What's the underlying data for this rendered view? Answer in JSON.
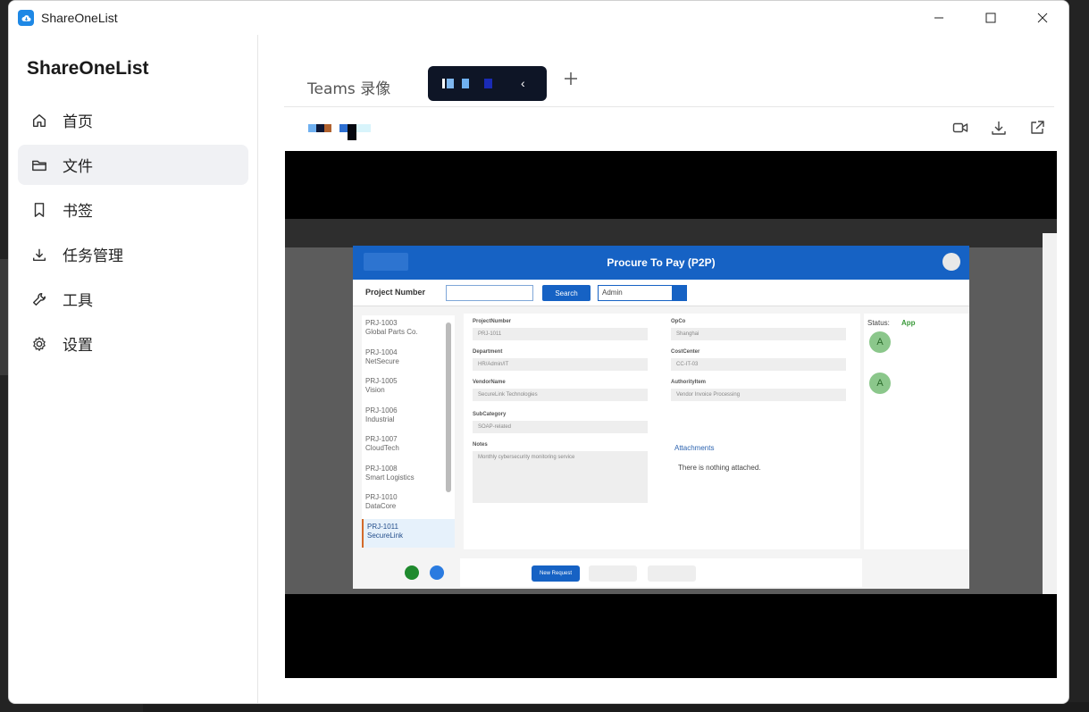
{
  "window": {
    "title": "ShareOneList",
    "controls": {
      "minimize": "minimize-icon",
      "maximize": "maximize-icon",
      "close": "close-icon"
    }
  },
  "sidebar": {
    "title": "ShareOneList",
    "items": [
      {
        "label": "首页",
        "icon": "home-icon",
        "active": false
      },
      {
        "label": "文件",
        "icon": "folder-icon",
        "active": true
      },
      {
        "label": "书签",
        "icon": "bookmark-icon",
        "active": false
      },
      {
        "label": "任务管理",
        "icon": "download-icon",
        "active": false
      },
      {
        "label": "工具",
        "icon": "wrench-icon",
        "active": false
      },
      {
        "label": "设置",
        "icon": "gear-icon",
        "active": false
      }
    ]
  },
  "tabs": {
    "first_label": "Teams 录像",
    "add_icon": "plus-icon"
  },
  "file_row": {
    "actions": [
      "video-icon",
      "download-icon",
      "open-external-icon"
    ]
  },
  "video": {
    "app_title": "Procure To Pay (P2P)",
    "project_number_label": "Project Number",
    "search_button": "Search",
    "select_value": "Admin",
    "projects": [
      {
        "id": "PRJ-1003",
        "name": "Global Parts Co."
      },
      {
        "id": "PRJ-1004",
        "name": "NetSecure"
      },
      {
        "id": "PRJ-1005",
        "name": "Vision"
      },
      {
        "id": "PRJ-1006",
        "name": "Industrial"
      },
      {
        "id": "PRJ-1007",
        "name": "CloudTech"
      },
      {
        "id": "PRJ-1008",
        "name": "Smart Logistics"
      },
      {
        "id": "PRJ-1010",
        "name": "DataCore"
      },
      {
        "id": "PRJ-1011",
        "name": "SecureLink"
      }
    ],
    "fields": {
      "project_number_label": "ProjectNumber",
      "project_number": "PRJ-1011",
      "opco_label": "OpCo",
      "opco": "Shanghai",
      "department_label": "Department",
      "department": "HR/Admin/IT",
      "cost_center_label": "CostCenter",
      "cost_center": "CC-IT-03",
      "vendor_label": "VendorName",
      "vendor": "SecureLink Technologies",
      "authority_label": "AuthorityItem",
      "authority": "Vendor Invoice Processing",
      "subcategory_label": "SubCategory",
      "subcategory": "SOAP-related",
      "notes_label": "Notes",
      "notes": "Monthly cybersecurity monitoring service"
    },
    "attachments_label": "Attachments",
    "attachments_empty": "There is nothing attached.",
    "status_label": "Status:",
    "status_value": "App",
    "approver_initial": "A",
    "new_request": "New Request"
  }
}
